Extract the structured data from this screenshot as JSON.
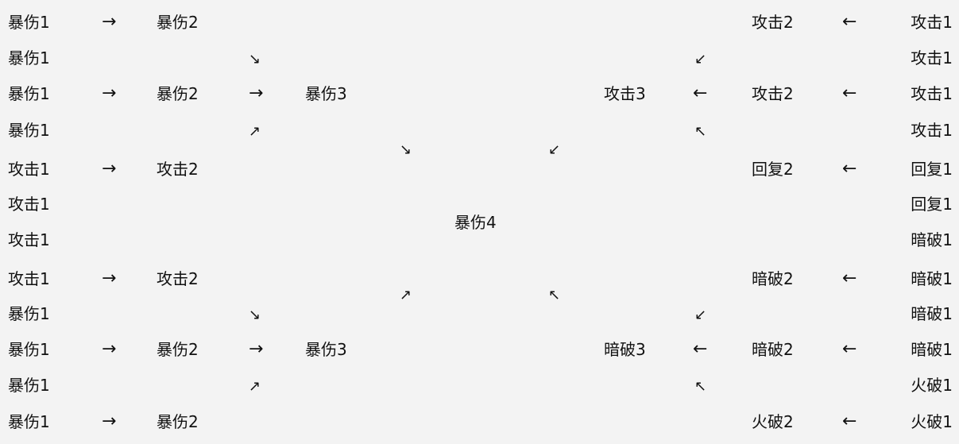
{
  "diagram": {
    "rows": [
      {
        "left": [
          "暴伤1",
          "→",
          "暴伤2"
        ],
        "right": [
          "攻击2",
          "←",
          "攻击1"
        ]
      },
      {
        "left": [
          "暴伤1"
        ],
        "right": [
          "攻击1"
        ]
      },
      {
        "left": [
          "暴伤1",
          "→",
          "暴伤2",
          "→",
          "暴伤3"
        ],
        "right": [
          "攻击3",
          "←",
          "攻击2",
          "←",
          "攻击1"
        ]
      },
      {
        "left": [
          "暴伤1"
        ],
        "right": [
          "攻击1"
        ]
      },
      {
        "left": [
          "攻击1",
          "→",
          "攻击2"
        ],
        "right": [
          "回复2",
          "←",
          "回复1"
        ]
      },
      {
        "left": [
          "攻击1"
        ],
        "right": [
          "回复1"
        ]
      },
      {
        "left": [
          "攻击1"
        ],
        "right": [
          "暗破1"
        ]
      },
      {
        "left": [
          "攻击1",
          "→",
          "攻击2"
        ],
        "right": [
          "暗破2",
          "←",
          "暗破1"
        ]
      },
      {
        "left": [
          "暴伤1"
        ],
        "right": [
          "暗破1"
        ]
      },
      {
        "left": [
          "暴伤1",
          "→",
          "暴伤2",
          "→",
          "暴伤3"
        ],
        "right": [
          "暗破3",
          "←",
          "暗破2",
          "←",
          "暗破1"
        ]
      },
      {
        "left": [
          "暴伤1"
        ],
        "right": [
          "火破1"
        ]
      },
      {
        "left": [
          "暴伤1",
          "→",
          "暴伤2"
        ],
        "right": [
          "火破2",
          "←",
          "火破1"
        ]
      }
    ],
    "center": "暴伤4",
    "diagonal_arrows": {
      "se": "↘",
      "ne": "↗",
      "sw": "↙",
      "nw": "↖"
    }
  }
}
